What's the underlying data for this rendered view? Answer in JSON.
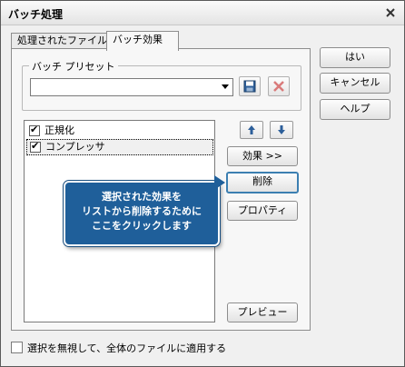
{
  "window": {
    "title": "バッチ処理"
  },
  "tabs": [
    {
      "label": "処理されたファイル",
      "active": false
    },
    {
      "label": "バッチ効果",
      "active": true
    }
  ],
  "preset": {
    "group_label": "バッチ プリセット",
    "value": "",
    "save_icon": "floppy-disk-icon",
    "delete_icon": "red-x-icon"
  },
  "effects": [
    {
      "label": "正規化",
      "checked": true,
      "selected": false
    },
    {
      "label": "コンプレッサ",
      "checked": true,
      "selected": true
    }
  ],
  "buttons": {
    "move_up_icon": "arrow-up-icon",
    "move_down_icon": "arrow-down-icon",
    "effects": "効果 >>",
    "delete": "削除",
    "properties": "プロパティ",
    "preview": "プレビュー"
  },
  "side_buttons": {
    "ok": "はい",
    "cancel": "キャンセル",
    "help": "ヘルプ"
  },
  "tooltip": {
    "lines": [
      "選択された効果を",
      "リストから削除するために",
      "ここをクリックします"
    ],
    "color": "#1f5f9a"
  },
  "footer": {
    "checkbox_label": "選択を無視して、全体のファイルに適用する",
    "checked": false
  }
}
